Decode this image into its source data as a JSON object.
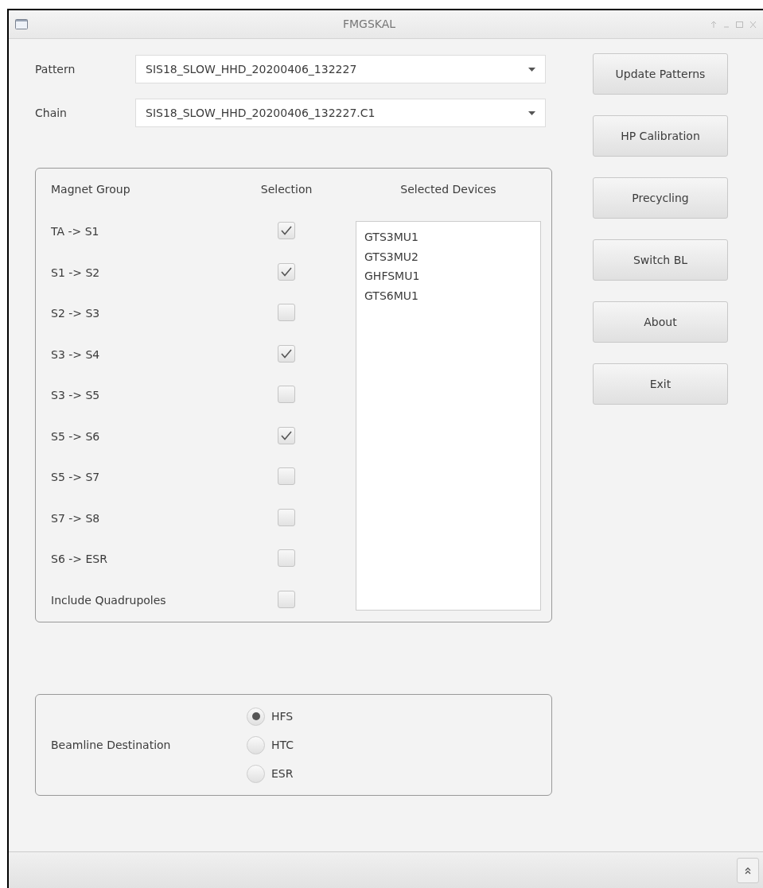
{
  "window": {
    "title": "FMGSKAL"
  },
  "fields": [
    {
      "label": "Pattern",
      "value": "SIS18_SLOW_HHD_20200406_132227"
    },
    {
      "label": "Chain",
      "value": "SIS18_SLOW_HHD_20200406_132227.C1"
    }
  ],
  "buttons": [
    "Update Patterns",
    "HP Calibration",
    "Precycling",
    "Switch BL",
    "About",
    "Exit"
  ],
  "magnet_groups": {
    "headers": [
      "Magnet Group",
      "Selection",
      "Selected Devices"
    ],
    "rows": [
      {
        "label": "TA -> S1",
        "checked": true
      },
      {
        "label": "S1 -> S2",
        "checked": true
      },
      {
        "label": "S2 -> S3",
        "checked": false
      },
      {
        "label": "S3 -> S4",
        "checked": true
      },
      {
        "label": "S3 -> S5",
        "checked": false
      },
      {
        "label": "S5 -> S6",
        "checked": true
      },
      {
        "label": "S5 -> S7",
        "checked": false
      },
      {
        "label": "S7 -> S8",
        "checked": false
      },
      {
        "label": "S6 -> ESR",
        "checked": false
      },
      {
        "label": "Include Quadrupoles",
        "checked": false
      }
    ],
    "devices": [
      "GTS3MU1",
      "GTS3MU2",
      "GHFSMU1",
      "GTS6MU1"
    ]
  },
  "beamline": {
    "label": "Beamline Destination",
    "options": [
      {
        "label": "HFS",
        "selected": true
      },
      {
        "label": "HTC",
        "selected": false
      },
      {
        "label": "ESR",
        "selected": false
      }
    ]
  }
}
